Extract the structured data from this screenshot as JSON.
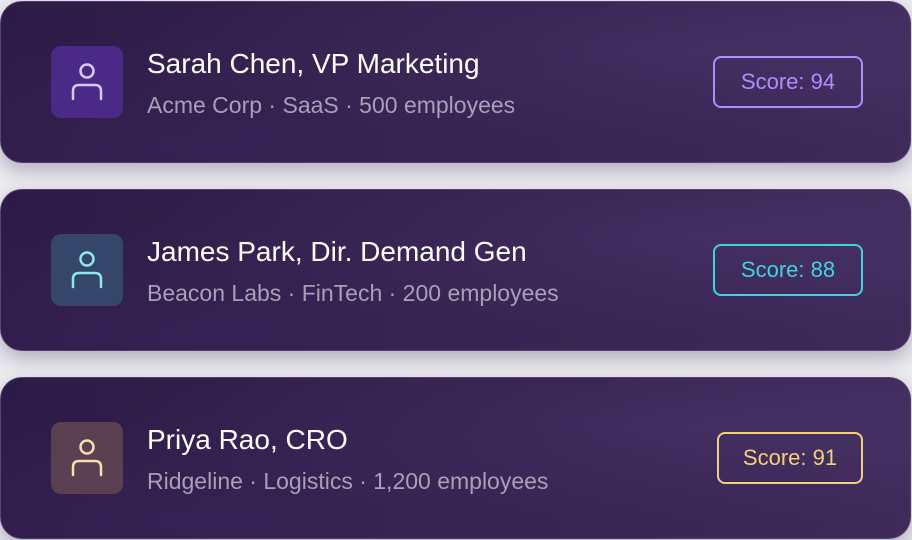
{
  "leads": [
    {
      "name": "Sarah Chen, VP Marketing",
      "details": "Acme Corp · SaaS · 500 employees",
      "score_label": "Score: 94",
      "icon": "person-icon",
      "avatar_bg": "#4a2a86",
      "icon_color": "#d9c8ff",
      "score_color": "#b28cff"
    },
    {
      "name": "James Park, Dir. Demand Gen",
      "details": "Beacon Labs · FinTech · 200 employees",
      "score_label": "Score: 88",
      "icon": "person-icon",
      "avatar_bg": "#36456a",
      "icon_color": "#8ee6ee",
      "score_color": "#3fd4dd"
    },
    {
      "name": "Priya Rao, CRO",
      "details": "Ridgeline · Logistics · 1,200 employees",
      "score_label": "Score: 91",
      "icon": "person-icon",
      "avatar_bg": "#5a4050",
      "icon_color": "#f6deb0",
      "score_color": "#f3cf7a"
    }
  ]
}
